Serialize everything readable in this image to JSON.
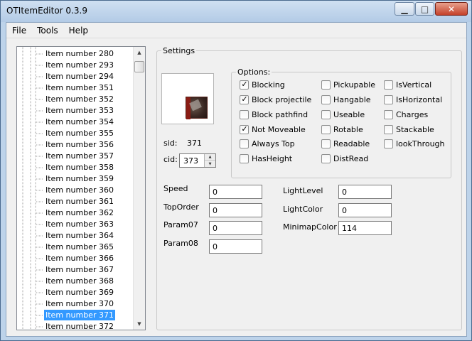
{
  "window": {
    "title": "OTItemEditor 0.3.9"
  },
  "titlebar_buttons": {
    "minimize": "▁",
    "maximize": "□",
    "close": "✕"
  },
  "menu": [
    "File",
    "Tools",
    "Help"
  ],
  "tree": {
    "items": [
      "Item number 280",
      "Item number 293",
      "Item number 294",
      "Item number 351",
      "Item number 352",
      "Item number 353",
      "Item number 354",
      "Item number 355",
      "Item number 356",
      "Item number 357",
      "Item number 358",
      "Item number 359",
      "Item number 360",
      "Item number 361",
      "Item number 362",
      "Item number 363",
      "Item number 364",
      "Item number 365",
      "Item number 366",
      "Item number 367",
      "Item number 368",
      "Item number 369",
      "Item number 370",
      "Item number 371",
      "Item number 372"
    ],
    "selected_index": 23,
    "scroll_up": "▲",
    "scroll_down": "▼"
  },
  "settings": {
    "legend": "Settings",
    "sid_label": "sid:",
    "sid_value": "371",
    "cid_label": "cid:",
    "cid_value": "373",
    "spin_up": "▲",
    "spin_down": "▼"
  },
  "options": {
    "legend": "Options:",
    "checkboxes": [
      {
        "label": "Blocking",
        "checked": true
      },
      {
        "label": "Block projectile",
        "checked": true
      },
      {
        "label": "Block pathfind",
        "checked": false
      },
      {
        "label": "Not Moveable",
        "checked": true
      },
      {
        "label": "Always Top",
        "checked": false
      },
      {
        "label": "HasHeight",
        "checked": false
      },
      {
        "label": "Pickupable",
        "checked": false
      },
      {
        "label": "Hangable",
        "checked": false
      },
      {
        "label": "Useable",
        "checked": false
      },
      {
        "label": "Rotable",
        "checked": false
      },
      {
        "label": "Readable",
        "checked": false
      },
      {
        "label": "DistRead",
        "checked": false
      },
      {
        "label": "IsVertical",
        "checked": false
      },
      {
        "label": "IsHorizontal",
        "checked": false
      },
      {
        "label": "Charges",
        "checked": false
      },
      {
        "label": "Stackable",
        "checked": false
      },
      {
        "label": "lookThrough",
        "checked": false
      }
    ],
    "check_mark": "✓"
  },
  "fields": {
    "left": [
      {
        "label": "Speed",
        "value": "0"
      },
      {
        "label": "TopOrder",
        "value": "0"
      },
      {
        "label": "Param07",
        "value": "0"
      },
      {
        "label": "Param08",
        "value": "0"
      }
    ],
    "right": [
      {
        "label": "LightLevel",
        "value": "0"
      },
      {
        "label": "LightColor",
        "value": "0"
      },
      {
        "label": "MinimapColor",
        "value": "114"
      }
    ]
  },
  "colors": {
    "selection": "#3399ff",
    "window_frame": "#bdd3ea",
    "close_button": "#c4412a"
  }
}
